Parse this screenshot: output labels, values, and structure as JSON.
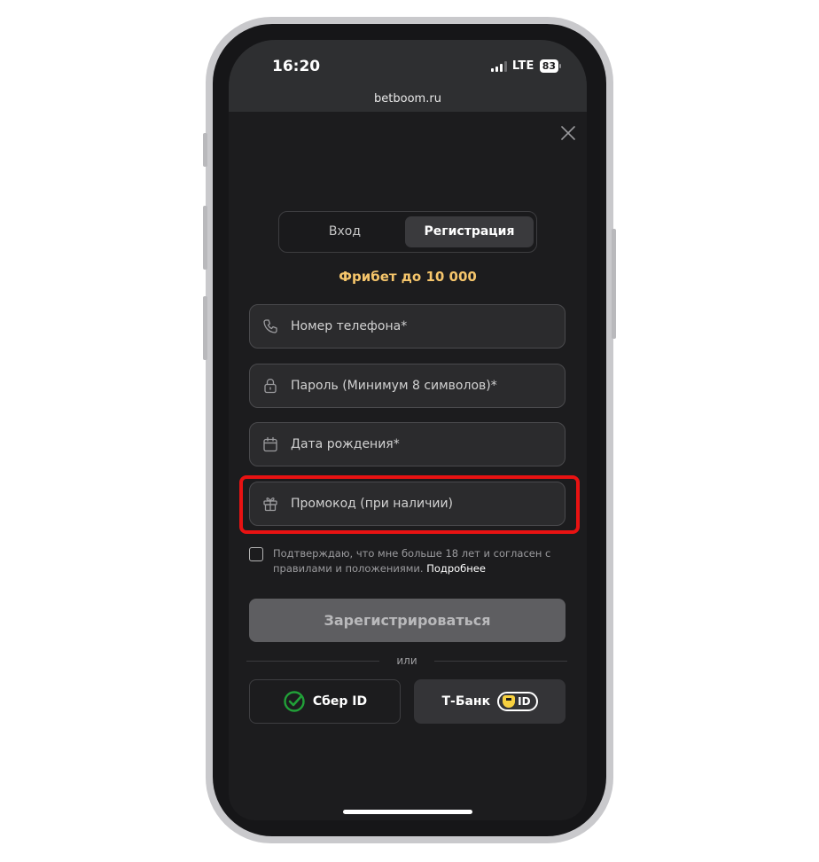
{
  "status_bar": {
    "time": "16:20",
    "network": "LTE",
    "battery": "83"
  },
  "browser": {
    "url": "betboom.ru"
  },
  "tabs": [
    {
      "label": "Вход",
      "active": false
    },
    {
      "label": "Регистрация",
      "active": true
    }
  ],
  "promo_banner": "Фрибет до 10 000",
  "fields": {
    "phone": {
      "placeholder": "Номер телефона*",
      "icon": "phone-icon"
    },
    "password": {
      "placeholder": "Пароль (Минимум 8 символов)*",
      "icon": "lock-icon"
    },
    "birthdate": {
      "placeholder": "Дата рождения*",
      "icon": "calendar-icon"
    },
    "promocode": {
      "placeholder": "Промокод (при наличии)",
      "icon": "gift-icon"
    }
  },
  "consent": {
    "text": "Подтверждаю, что мне больше 18 лет и согласен с правилами и положениями.",
    "link": "Подробнее",
    "checked": false
  },
  "submit_label": "Зарегистрироваться",
  "divider_text": "или",
  "sber_button": {
    "label": "Сбер ID"
  },
  "tbank_button": {
    "label": "Т-Банк",
    "badge": "ID"
  },
  "colors": {
    "accent_gold": "#f5c56b",
    "highlight_red": "#e81212",
    "sber_green": "#21a038",
    "tbank_yellow": "#f7d03f"
  }
}
